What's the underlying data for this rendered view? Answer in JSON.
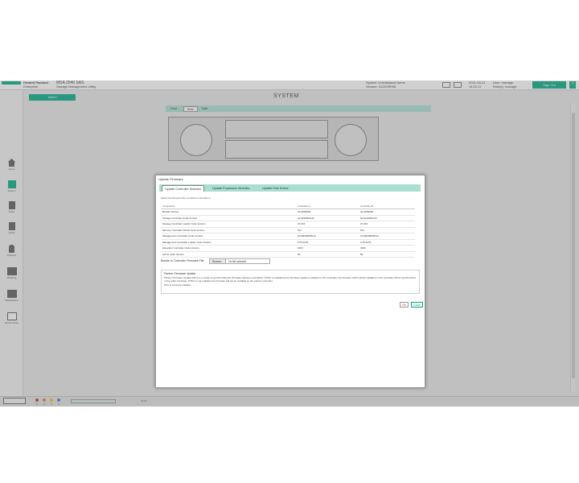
{
  "header": {
    "company_line1": "Hewlett Packard",
    "company_line2": "Enterprise",
    "product_line1": "MSA 2040 SAS",
    "product_line2": "Storage Management Utility",
    "system_line1": "System: Uninitialized Name",
    "system_line2": "Version: GL220R006",
    "date_line1": "2021-09-21",
    "date_line2": "14:22:11",
    "user_line1": "User: manage",
    "user_line2": "Role(s): manage",
    "signout_label": "Sign Out",
    "help_label": "?"
  },
  "nav": {
    "items": [
      {
        "label": "Home",
        "icon": "home-icon"
      },
      {
        "label": "System",
        "icon": "system-icon"
      },
      {
        "label": "Pools",
        "icon": "pools-icon"
      },
      {
        "label": "Hosts",
        "icon": "hosts-icon"
      },
      {
        "label": "Volumes",
        "icon": "volumes-icon"
      },
      {
        "label": "Mapping",
        "icon": "mapping-icon"
      },
      {
        "label": "Replications",
        "icon": "replications-icon"
      },
      {
        "label": "Performance",
        "icon": "performance-icon"
      }
    ]
  },
  "page": {
    "action_label": "Action",
    "title": "SYSTEM",
    "tabs": [
      "Front",
      "Rear",
      "Table"
    ],
    "selected_tab": "Rear"
  },
  "statusbar": {
    "counts": [
      "0",
      "0",
      "0",
      "0"
    ],
    "time": "14:22"
  },
  "dialog": {
    "title": "Update Firmware",
    "tabs": [
      "Update Controller Modules",
      "Update Expansion Modules",
      "Update Disk Drives"
    ],
    "description": "Select the firmware file to install to controller A.",
    "table_header": [
      "Component",
      "Controller A",
      "Controller B"
    ],
    "rows": [
      {
        "name": "Bundle Version",
        "a": "GL220R006",
        "b": "GL220R006"
      },
      {
        "name": "Storage Controller Code Version",
        "a": "GLS210R06-02",
        "b": "GLS210R06-02"
      },
      {
        "name": "Storage Controller Loader Code Version",
        "a": "27.016",
        "b": "27.016"
      },
      {
        "name": "Memory Controller FPGA Code Version",
        "a": "N/A",
        "b": "N/A"
      },
      {
        "name": "Management Controller Code Version",
        "a": "GLM220R008-01",
        "b": "GLM220R008-01"
      },
      {
        "name": "Management Controller Loader Code Version",
        "a": "6.15.2276",
        "b": "6.15.2276"
      },
      {
        "name": "Expander Controller Code Version",
        "a": "3203",
        "b": "3203"
      },
      {
        "name": "CPLD Code Version",
        "a": "83",
        "b": "83"
      }
    ],
    "bundle_label": "Bundle or Controller Firmware File:",
    "browse_label": "Browse...",
    "no_file_text": "No file selected.",
    "pfu_title": "Partner Firmware Update",
    "pfu_text": "Partner Firmware Update (PFU) is a mode of synchronizing the firmware between controllers. If PFU is enabled and a firmware update is initiated on the controller, the firmware which will be installed on this controller will be synchronized to the other controller. If PFU is not enabled, the firmware will not be installed on the partner controller.",
    "pfu_status": "PFU is currently enabled.",
    "ok_label": "OK",
    "close_label": "Close"
  }
}
